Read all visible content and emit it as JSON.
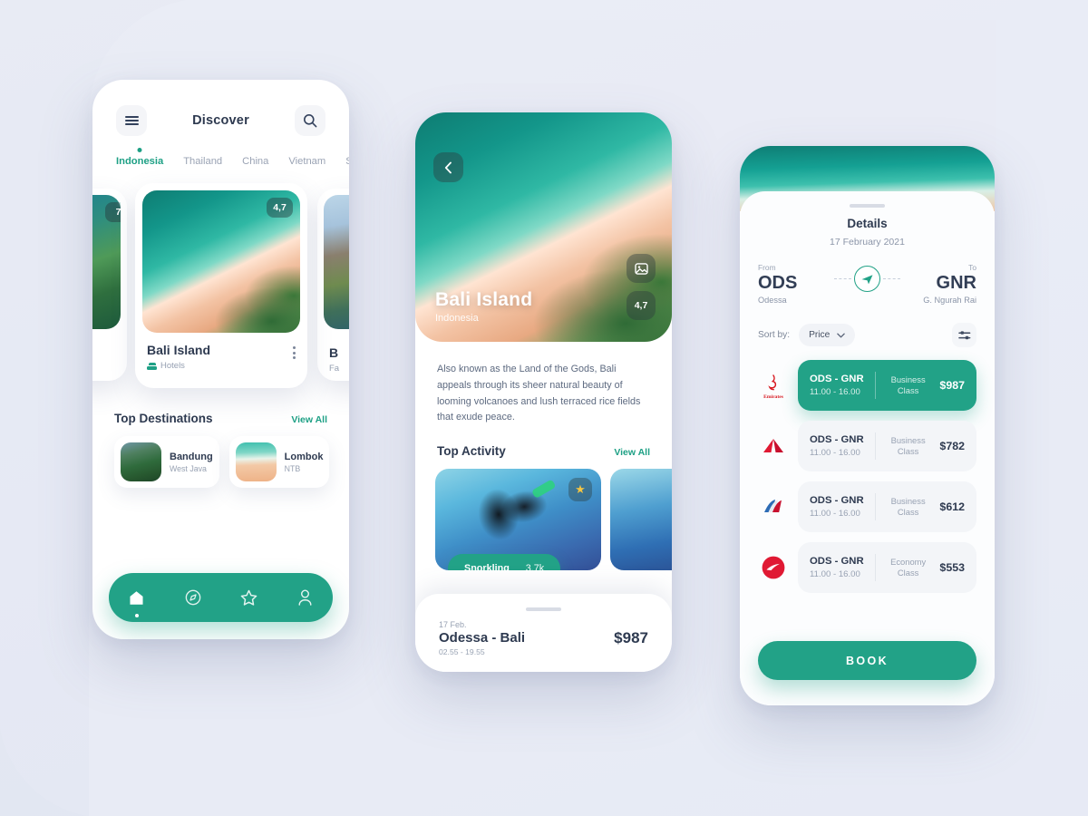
{
  "background": {
    "color": "#e7eaf3"
  },
  "theme": {
    "accent": "#22a287",
    "text_dark": "#2e3a50",
    "text_muted": "#98a2b3"
  },
  "phone_discover": {
    "header": {
      "menu_icon": "hamburger-menu-icon",
      "title": "Discover",
      "search_icon": "search-icon"
    },
    "tabs": [
      {
        "label": "Indonesia",
        "active": true
      },
      {
        "label": "Thailand",
        "active": false
      },
      {
        "label": "China",
        "active": false
      },
      {
        "label": "Vietnam",
        "active": false
      },
      {
        "label": "S",
        "active": false
      }
    ],
    "carousel": {
      "left_card": {
        "rating": "7"
      },
      "main_card": {
        "rating": "4,7",
        "name": "Bali Island",
        "category": "Hotels",
        "category_icon": "hotel-bed-icon",
        "more_icon": "kebab-menu-icon"
      },
      "right_card": {
        "name": "B",
        "category": "Fa"
      }
    },
    "top_destinations": {
      "title": "Top Destinations",
      "view_all": "View All",
      "items": [
        {
          "name": "Bandung",
          "region": "West Java"
        },
        {
          "name": "Lombok",
          "region": "NTB"
        }
      ]
    },
    "bottom_nav": [
      {
        "icon": "home-icon",
        "active": true
      },
      {
        "icon": "compass-icon",
        "active": false
      },
      {
        "icon": "star-icon",
        "active": false
      },
      {
        "icon": "profile-icon",
        "active": false
      }
    ]
  },
  "phone_detail": {
    "back_icon": "chevron-left-icon",
    "hero": {
      "title": "Bali Island",
      "subtitle": "Indonesia",
      "gallery_icon": "image-gallery-icon",
      "rating": "4,7"
    },
    "description": "Also known as the Land of the Gods, Bali appeals through its sheer natural beauty of looming volcanoes and lush terraced rice fields that exude peace.",
    "activity": {
      "title": "Top Activity",
      "view_all": "View All",
      "items": [
        {
          "name": "Snorkling",
          "count": "3.7k",
          "featured_icon": "star-icon"
        },
        {
          "name": "",
          "count": ""
        }
      ]
    },
    "booking_sheet": {
      "date": "17 Feb.",
      "route": "Odessa - Bali",
      "time": "02.55 - 19.55",
      "price": "$987"
    }
  },
  "phone_flights": {
    "title": "Details",
    "date": "17 February 2021",
    "route": {
      "from_label": "From",
      "from_code": "ODS",
      "from_city": "Odessa",
      "to_label": "To",
      "to_code": "GNR",
      "to_city": "G. Ngurah Rai",
      "plane_icon": "airplane-icon"
    },
    "sort": {
      "label": "Sort by:",
      "value": "Price",
      "chevron_icon": "chevron-down-icon",
      "filter_icon": "filter-sliders-icon"
    },
    "flights": [
      {
        "airline": "Emirates",
        "route": "ODS - GNR",
        "time": "11.00 - 16.00",
        "class": "Business Class",
        "price": "$987",
        "selected": true
      },
      {
        "airline": "Delta",
        "route": "ODS - GNR",
        "time": "11.00 - 16.00",
        "class": "Business Class",
        "price": "$782",
        "selected": false
      },
      {
        "airline": "American Airlines",
        "route": "ODS - GNR",
        "time": "11.00 - 16.00",
        "class": "Business Class",
        "price": "$612",
        "selected": false
      },
      {
        "airline": "AirAsia",
        "route": "ODS - GNR",
        "time": "11.00 - 16.00",
        "class": "Economy Class",
        "price": "$553",
        "selected": false
      }
    ],
    "book_button": "BOOK"
  }
}
